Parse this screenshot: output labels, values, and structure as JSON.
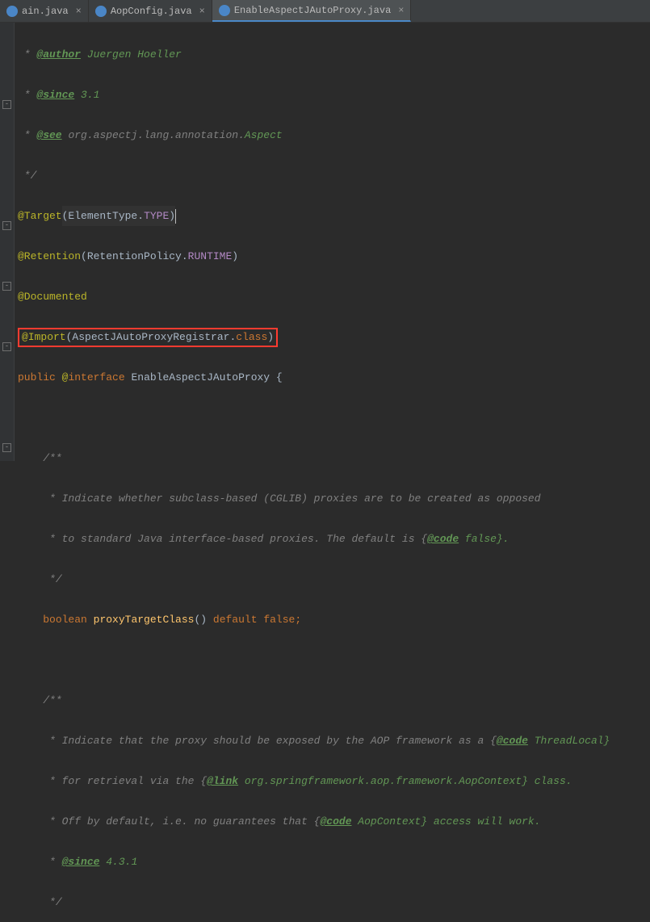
{
  "tabs": [
    {
      "label": "ain.java",
      "iconClass": "icon-j",
      "closeVisible": true,
      "active": false
    },
    {
      "label": "AopConfig.java",
      "iconClass": "icon-c",
      "closeVisible": true,
      "active": false
    },
    {
      "label": "EnableAspectJAutoProxy.java",
      "iconClass": "icon-c",
      "closeVisible": true,
      "active": true
    }
  ],
  "code": {
    "l1_author": "@author",
    "l1_name": "Juergen Hoeller",
    "l2_since": "@since",
    "l2_ver": "3.1",
    "l3_see": "@see",
    "l3_pkg": "org.aspectj.lang.annotation.",
    "l3_cls": "Aspect",
    "l4_end": " */",
    "l5_anno": "@Target",
    "l5_p1": "(",
    "l5_cls": "ElementType",
    "l5_dot": ".",
    "l5_val": "TYPE",
    "l5_p2": ")",
    "l6_anno": "@Retention",
    "l6_p1": "(",
    "l6_cls": "RetentionPolicy",
    "l6_dot": ".",
    "l6_val": "RUNTIME",
    "l6_p2": ")",
    "l7_anno": "@Documented",
    "l8_anno": "@Import",
    "l8_p1": "(",
    "l8_cls": "AspectJAutoProxyRegistrar",
    "l8_dot": ".",
    "l8_kw": "class",
    "l8_p2": ")",
    "l9_vis": "public",
    "l9_at": "@",
    "l9_kw": "interface",
    "l9_name": "EnableAspectJAutoProxy",
    "l9_brace": " {",
    "l10_open": "/**",
    "l11_txt": " * Indicate whether subclass-based (CGLIB) proxies are to be created as opposed",
    "l12_a": " * to standard Java interface-based proxies. The default is {",
    "l12_code": "@code",
    "l12_b": " false}.",
    "l13_end": " */",
    "l14_type": "boolean",
    "l14_name": "proxyTargetClass",
    "l14_paren": "()",
    "l14_def": "default",
    "l14_val": "false",
    "l14_semi": ";",
    "l15_open": "/**",
    "l16_a": " * Indicate that the proxy should be exposed by the AOP framework as a {",
    "l16_code": "@code",
    "l16_b": " ThreadLocal}",
    "l17_a": " * for retrieval via the {",
    "l17_link": "@link",
    "l17_b": " org.springframework.aop.framework.AopContext} class.",
    "l18_a": " * Off by default, i.e. no guarantees that {",
    "l18_code": "@code",
    "l18_b": " AopContext} access will work.",
    "l19_since": "@since",
    "l19_ver": " 4.3.1",
    "l20_end": " */"
  },
  "star": " * ",
  "close_glyph": "×"
}
